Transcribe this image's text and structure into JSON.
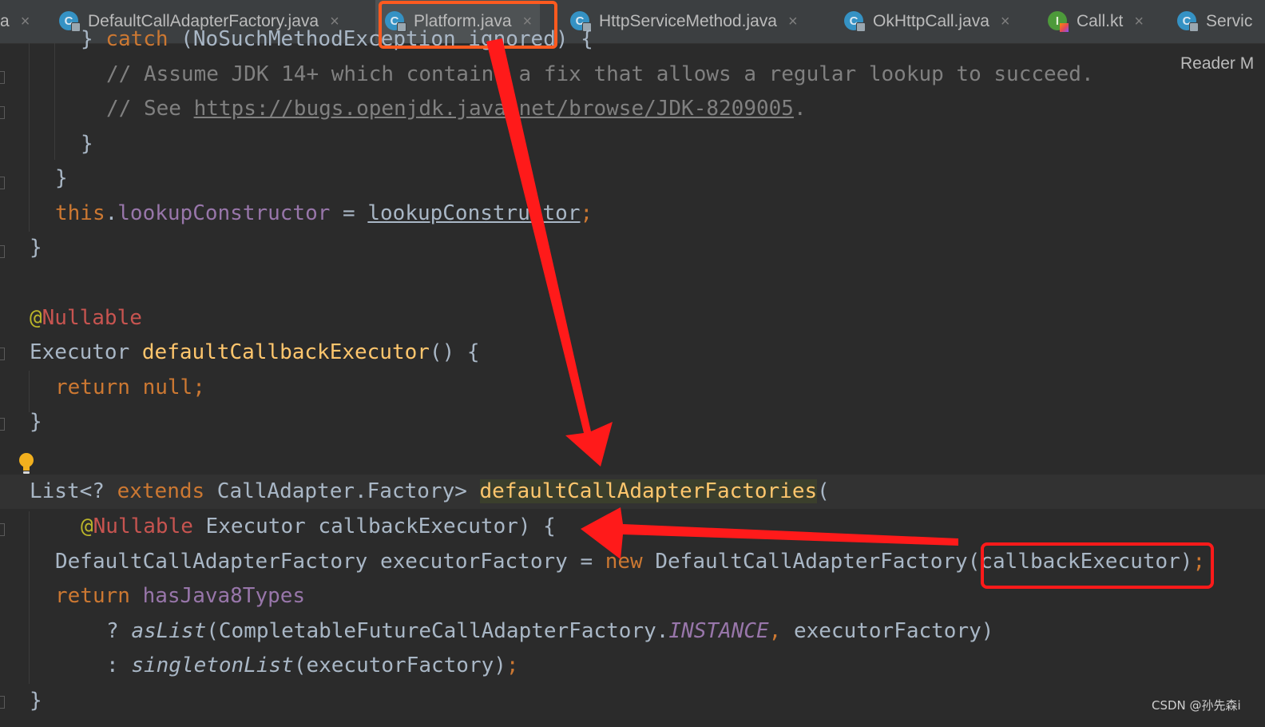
{
  "tabs": [
    {
      "label": "a",
      "close": "×"
    },
    {
      "label": "DefaultCallAdapterFactory.java",
      "close": "×",
      "icon": "C"
    },
    {
      "label": "Platform.java",
      "close": "×",
      "icon": "C"
    },
    {
      "label": "HttpServiceMethod.java",
      "close": "×",
      "icon": "C"
    },
    {
      "label": "OkHttpCall.java",
      "close": "×",
      "icon": "C"
    },
    {
      "label": "Call.kt",
      "close": "×",
      "icon": "I"
    },
    {
      "label": "Servic",
      "icon": "C"
    }
  ],
  "active_tab": "Platform.java",
  "reader_mode": "Reader M",
  "code": {
    "l0": {
      "a": "} ",
      "b": "catch",
      "c": " (NoSuchMethodException ignored) {"
    },
    "l1": "// Assume JDK 14+ which contains a fix that allows a regular lookup to succeed.",
    "l2": {
      "a": "// See ",
      "b": "https://bugs.openjdk.java.net/browse/JDK-8209005",
      "c": "."
    },
    "l3": "}",
    "l4": "}",
    "l5": {
      "a": "this",
      "b": ".",
      "c": "lookupConstructor",
      "d": " = ",
      "e": "lookupConstructor",
      "f": ";"
    },
    "l6": "}",
    "l8": {
      "a": "@",
      "b": "Nullable"
    },
    "l9": {
      "a": "Executor ",
      "b": "defaultCallbackExecutor",
      "c": "() {"
    },
    "l10": {
      "a": "return null",
      "b": ";"
    },
    "l11": "}",
    "l13": {
      "a": "List<? ",
      "b": "extends",
      "c": " CallAdapter.Factory> ",
      "d": "defaultCallAdapterFactories",
      "e": "("
    },
    "l14": {
      "a": "@",
      "b": "Nullable",
      "c": " Executor callbackExecutor) {"
    },
    "l15": {
      "a": "DefaultCallAdapterFactory executorFactory = ",
      "b": "new",
      "c": " DefaultCallAdapterFactory(callbackExecutor)",
      "d": ";"
    },
    "l16": {
      "a": "return ",
      "b": "hasJava8Types"
    },
    "l17": {
      "a": "? ",
      "b": "asList",
      "c": "(CompletableFutureCallAdapterFactory.",
      "d": "INSTANCE",
      "e": ", ",
      "f": "executorFactory)"
    },
    "l18": {
      "a": ": ",
      "b": "singletonList",
      "c": "(executorFactory)",
      "d": ";"
    },
    "l19": "}"
  },
  "watermark": "CSDN @孙先森i",
  "colors": {
    "annotation": "#ff1a1a",
    "keyword": "#cc7832",
    "method": "#ffc66d",
    "field": "#9876aa",
    "comment": "#808080",
    "text": "#a9b7c6",
    "background": "#2b2b2b"
  },
  "icons": [
    "java-class-icon",
    "kotlin-interface-icon",
    "lightbulb-icon",
    "close-icon"
  ]
}
